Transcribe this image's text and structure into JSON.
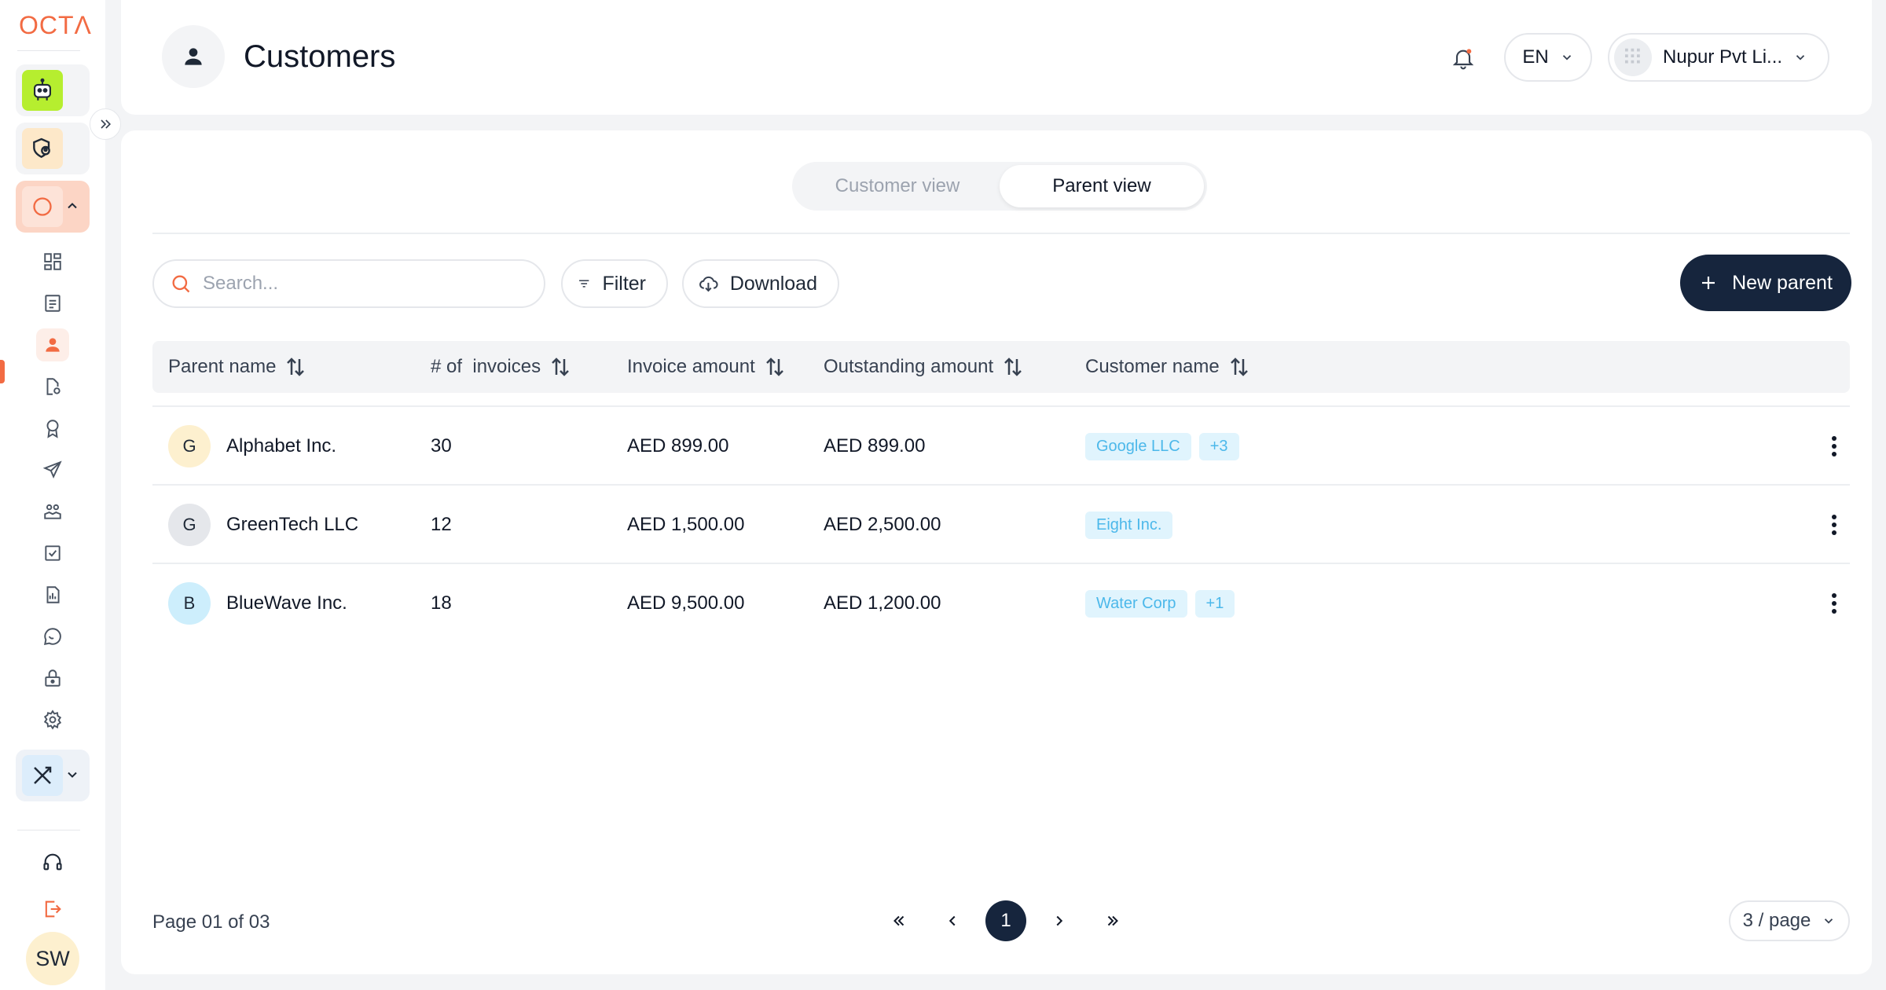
{
  "brand": {
    "logo_text": "OCTΛ",
    "accent": "#f26b43",
    "dark": "#16253d"
  },
  "sidebar": {
    "tiles": [
      {
        "name": "bot-app",
        "icon": "robot-icon"
      },
      {
        "name": "user-shield-app",
        "icon": "user-shield-icon"
      },
      {
        "name": "circle-app",
        "icon": "circle-icon"
      }
    ],
    "nav_icons": [
      "grid-icon",
      "document-icon",
      "customer-icon",
      "file-settings-icon",
      "badge-icon",
      "send-icon",
      "team-icon",
      "checkbox-icon",
      "report-icon",
      "chat-icon",
      "lock-star-icon",
      "gear-icon"
    ],
    "tools_tile_icon": "tools-icon",
    "bottom_icons": [
      "headset-icon",
      "logout-icon"
    ],
    "avatar_initials": "SW"
  },
  "header": {
    "title": "Customers",
    "language": "EN",
    "organization": "Nupur Pvt Li..."
  },
  "view_toggle": {
    "options": [
      "Customer view",
      "Parent view"
    ],
    "active": "Parent view"
  },
  "toolbar": {
    "search_placeholder": "Search...",
    "filter_label": "Filter",
    "download_label": "Download",
    "new_label": "New parent"
  },
  "table": {
    "columns": [
      "Parent name",
      "# of  invoices",
      "Invoice amount",
      "Outstanding amount",
      "Customer name"
    ],
    "rows": [
      {
        "initial": "G",
        "avatar_color": "#fdf0cf",
        "name": "Alphabet Inc.",
        "invoices": "30",
        "invoice_amount": "AED 899.00",
        "outstanding": "AED 899.00",
        "customer": "Google LLC",
        "more": "+3"
      },
      {
        "initial": "G",
        "avatar_color": "#e5e7eb",
        "name": "GreenTech LLC",
        "invoices": "12",
        "invoice_amount": "AED 1,500.00",
        "outstanding": "AED 2,500.00",
        "customer": "Eight Inc.",
        "more": ""
      },
      {
        "initial": "B",
        "avatar_color": "#cdeefc",
        "name": "BlueWave Inc.",
        "invoices": "18",
        "invoice_amount": "AED 9,500.00",
        "outstanding": "AED 1,200.00",
        "customer": "Water Corp",
        "more": "+1"
      }
    ]
  },
  "pagination": {
    "info": "Page 01 of 03",
    "current": "1",
    "per_page": "3 / page"
  }
}
